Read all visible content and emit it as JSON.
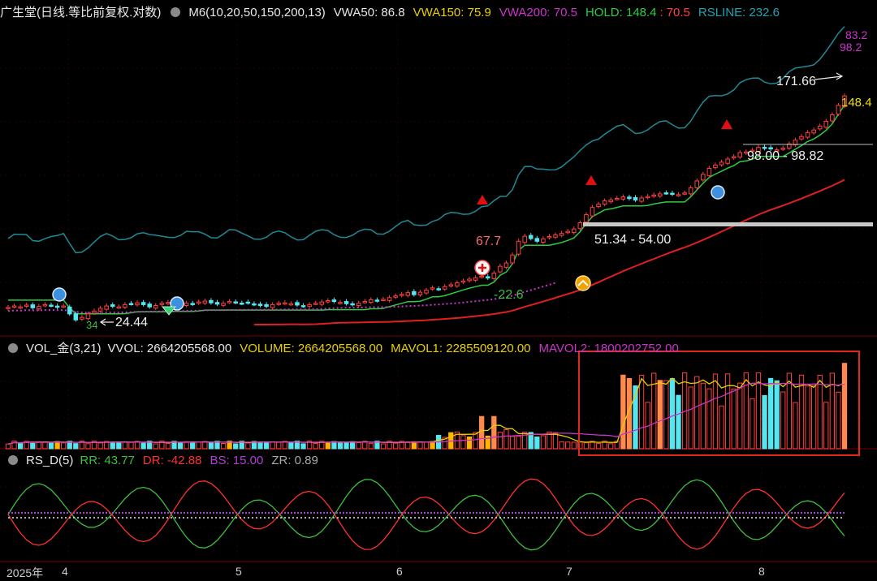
{
  "main_header": {
    "stock": "广生堂(日线.等比前复权.对数)",
    "indicator": "M6(10,20,50,150,200,13)",
    "vwa50": "VWA50: 86.8",
    "vwa150": "VWA150: 75.9",
    "vwa200": "VWA200: 70.5",
    "hold": "HOLD: 148.4",
    "hold_sep": ":",
    "hold2": "70.5",
    "rsline": "RSLINE: 232.6"
  },
  "vol_header": {
    "name": "VOL_金(3,21)",
    "vvol": "VVOL: 2664205568.00",
    "volume": "VOLUME: 2664205568.00",
    "mavol1": "MAVOL1: 2285509120.00",
    "mavol2": "MAVOL2: 1800202752.00"
  },
  "rs_header": {
    "name": "RS_D(5)",
    "rr": "RR: 43.77",
    "dr": "DR: -42.88",
    "bs": "BS: 15.00",
    "zr": "ZR: 0.89"
  },
  "price_labels": {
    "right_top": "83.2",
    "right_second": "98.2",
    "high_label": "171.66",
    "hold_right": "148.4",
    "zone_upper": "98.00 - 98.82",
    "zone_lower": "51.34 - 54.00",
    "peak_label": "67.7",
    "low_label": "24.44",
    "low_prefix": "34",
    "signal_label": "-22.6"
  },
  "x_axis": {
    "year": "2025年",
    "ticks": [
      "4",
      "5",
      "6",
      "7",
      "8"
    ]
  },
  "colors": {
    "up": "#ff4040",
    "down": "#55e6f0",
    "rsline": "#1f8a96",
    "hold": "#2ecc40",
    "vwa150": "#e8d000",
    "vwa200": "#cc33cc",
    "ma": "#e02020",
    "zone": "#c8c8c8",
    "vol_gold": "#ffb300",
    "vol_orange": "#ff8a4c",
    "highlight": "#e0281e",
    "rr": "#3fbf3f",
    "dr": "#ff3030",
    "bs": "#b040d0",
    "zr": "#aaaaaa"
  },
  "chart_data": [
    {
      "type": "candlestick",
      "title": "广生堂(日线.等比前复权.对数)",
      "x_ticks": [
        "4",
        "5",
        "6",
        "7",
        "8"
      ],
      "series": [
        {
          "name": "HOLD",
          "last": 148.4
        },
        {
          "name": "VWA50",
          "last": 86.8
        },
        {
          "name": "VWA150",
          "last": 75.9
        },
        {
          "name": "VWA200",
          "last": 70.5
        },
        {
          "name": "RSLINE",
          "last": 232.6
        }
      ],
      "annotations": [
        "171.66",
        "148.4",
        "98.00 - 98.82",
        "51.34 - 54.00",
        "67.7",
        "24.44",
        "-22.6",
        "83.2",
        "98.2"
      ],
      "closes": [
        27,
        27.3,
        27.1,
        27.5,
        26.9,
        27.2,
        27.6,
        27.4,
        27.0,
        27.3,
        25.6,
        24.4,
        24.9,
        25.6,
        26.2,
        26.8,
        27.3,
        27.2,
        27.1,
        27.6,
        27.8,
        28.0,
        27.6,
        27.1,
        27.4,
        27.9,
        28.1,
        27.8,
        27.6,
        27.9,
        27.7,
        28.2,
        28.4,
        28.0,
        27.7,
        27.9,
        28.3,
        28.1,
        27.9,
        28.0,
        27.7,
        27.4,
        27.2,
        27.6,
        27.9,
        28.0,
        27.8,
        27.5,
        27.3,
        27.6,
        27.9,
        28.2,
        28.5,
        28.3,
        28.1,
        27.8,
        27.6,
        27.9,
        28.3,
        28.7,
        28.5,
        28.8,
        29.2,
        29.6,
        30.0,
        30.4,
        29.9,
        30.5,
        31.0,
        31.6,
        31.3,
        31.9,
        32.4,
        32.9,
        33.4,
        33.9,
        34.3,
        34.7,
        34.2,
        35.6,
        37.6,
        38.6,
        41.2,
        46.0,
        47.9,
        47.0,
        46.0,
        46.9,
        47.8,
        48.4,
        49.0,
        49.8,
        50.8,
        53.4,
        57.0,
        60.4,
        62.0,
        63.7,
        64.2,
        65.0,
        65.8,
        64.9,
        64.1,
        65.2,
        66.0,
        66.8,
        67.4,
        67.9,
        67.2,
        67.0,
        67.9,
        70.8,
        74.8,
        78.9,
        82.8,
        85.0,
        87.0,
        89.2,
        91.0,
        94.0,
        94.5,
        95.8,
        98.0,
        97.2,
        96.8,
        96.1,
        97.4,
        100.8,
        103.9,
        107.0,
        110.5,
        112.8,
        116.4,
        121.0,
        127.5,
        137.6,
        148.4
      ]
    },
    {
      "type": "bar",
      "title": "VOL_金(3,21)",
      "series": [
        {
          "name": "VVOL",
          "last": 2664205568.0
        },
        {
          "name": "VOLUME",
          "last": 2664205568.0
        },
        {
          "name": "MAVOL1",
          "last": 2285509120.0
        },
        {
          "name": "MAVOL2",
          "last": 1800202752.0
        }
      ]
    },
    {
      "type": "line",
      "title": "RS_D(5)",
      "series": [
        {
          "name": "RR",
          "last": 43.77
        },
        {
          "name": "DR",
          "last": -42.88
        },
        {
          "name": "BS",
          "last": 15.0
        },
        {
          "name": "ZR",
          "last": 0.89
        }
      ]
    }
  ]
}
